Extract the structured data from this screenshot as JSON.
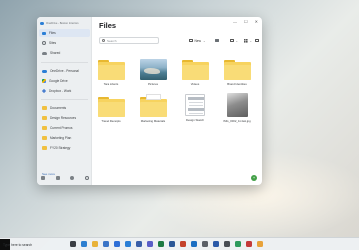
{
  "window": {
    "account_title": "OneDrive - Boston Interiors",
    "controls": {
      "minimize": "—",
      "maximize": "☐",
      "close": "✕"
    }
  },
  "sidebar": {
    "items": [
      {
        "label": "Files",
        "icon": "files-icon",
        "active": true
      },
      {
        "label": "Sites",
        "icon": "recent-icon",
        "active": false
      },
      {
        "label": "Shared",
        "icon": "shared-icon",
        "active": false
      }
    ],
    "accounts": [
      {
        "label": "OneDrive - Personal",
        "icon": "cloud-icon"
      },
      {
        "label": "Google Drive",
        "icon": "google-drive-icon"
      },
      {
        "label": "Dropbox - Work",
        "icon": "dropbox-icon"
      }
    ],
    "folders": [
      {
        "label": "Documents"
      },
      {
        "label": "Design Resources"
      },
      {
        "label": "Current Promos"
      },
      {
        "label": "Marketing Plan"
      },
      {
        "label": "FY20 Strategy"
      }
    ],
    "see_more": "See more"
  },
  "main": {
    "title": "Files",
    "search_placeholder": "Search",
    "new_label": "New",
    "items": [
      {
        "name": "Tara Liberts",
        "kind": "folder"
      },
      {
        "name": "Pictures",
        "kind": "folder-photo"
      },
      {
        "name": "Videos",
        "kind": "folder"
      },
      {
        "name": "Brand Identities",
        "kind": "folder"
      },
      {
        "name": "Travel Receipts",
        "kind": "folder"
      },
      {
        "name": "Marketing Materials",
        "kind": "folder"
      },
      {
        "name": "Design Sketch",
        "kind": "document"
      },
      {
        "name": "IMG_0002_11.fast.jpg",
        "kind": "image"
      }
    ],
    "fab_label": "+"
  },
  "taskbar": {
    "search_placeholder": "Type here to search",
    "apps": [
      "task-view-icon",
      "edge-icon",
      "explorer-icon",
      "store-icon",
      "mail-icon",
      "onedrive-icon",
      "photos-icon",
      "teams-icon",
      "excel-icon",
      "word-icon",
      "powerpoint-icon",
      "outlook-icon",
      "settings-icon",
      "calendar-icon",
      "calculator-icon",
      "maps-icon",
      "news-icon",
      "weather-icon"
    ],
    "app_colors": [
      "#3b3f44",
      "#2d7fd0",
      "#e8b23a",
      "#3b75c7",
      "#2f6fd6",
      "#2b7fd6",
      "#3a5fa8",
      "#5b5fc7",
      "#1d7a43",
      "#2b5797",
      "#c4422c",
      "#1b6ec2",
      "#5b6067",
      "#2b5aa8",
      "#4a4f55",
      "#2e9a5c",
      "#c43a3a",
      "#e8a23a"
    ]
  }
}
